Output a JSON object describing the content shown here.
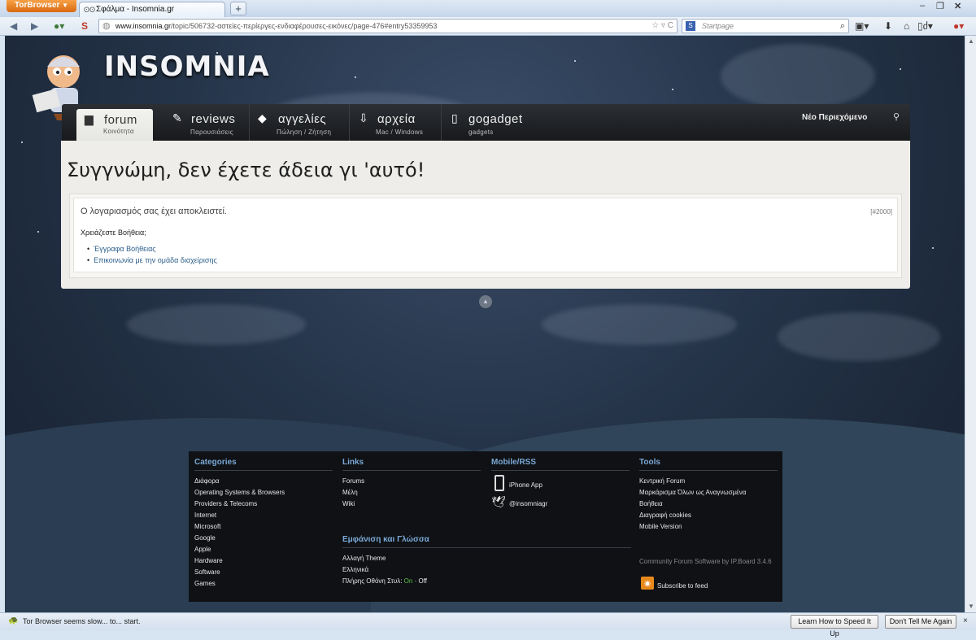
{
  "browser": {
    "tor_button": "TorBrowser",
    "tab_title": "Σφάλμα - Insomnia.gr",
    "new_tab": "+",
    "url_domain": "www.insomnia.gr",
    "url_path": "/topic/506732-αστείες-περίεργες-ενδιαφέρουσες-εικόνες/page-476#entry53359953",
    "search_engine_placeholder": "Startpage"
  },
  "site": {
    "logo": "INSOMNIA",
    "nav_tabs": [
      {
        "label": "forum",
        "sub": "Κοινότητα"
      },
      {
        "label": "reviews",
        "sub": "Παρουσιάσεις"
      },
      {
        "label": "αγγελίες",
        "sub": "Πώληση / Ζήτηση"
      },
      {
        "label": "αρχεία",
        "sub": "Mac / Windows"
      },
      {
        "label": "gogadget",
        "sub": "gadgets"
      }
    ],
    "new_content": "Νέο Περιεχόμενο"
  },
  "error": {
    "title": "Συγγνώμη, δεν έχετε άδεια γι 'αυτό!",
    "message": "Ο λογαριασμός σας έχει αποκλειστεί.",
    "code": "[#2000]",
    "help_question": "Χρειάζεστε Βοήθεια;",
    "help_links": [
      "Έγγραφα Βοήθειας",
      "Επικοινωνία με την ομάδα διαχείρισης"
    ]
  },
  "footer": {
    "categories": {
      "title": "Categories",
      "items": [
        "Διάφορα",
        "Operating Systems & Browsers",
        "Providers & Telecoms",
        "Internet",
        "Microsoft",
        "Google",
        "Apple",
        "Hardware",
        "Software",
        "Games"
      ]
    },
    "links": {
      "title": "Links",
      "items": [
        "Forums",
        "Μέλη",
        "Wiki"
      ]
    },
    "appearance": {
      "title": "Εμφάνιση και Γλώσσα",
      "change_theme": "Αλλαγή Theme",
      "language": "Ελληνικά",
      "fullscreen_label": "Πλήρης Οθόνη Στυλ:",
      "on": "On",
      "separator": "·",
      "off": "Off"
    },
    "mobile": {
      "title": "Mobile/RSS",
      "iphone": "iPhone App",
      "twitter": "@insomniagr"
    },
    "tools": {
      "title": "Tools",
      "items": [
        "Κεντρική Forum",
        "Μαρκάρισμα Όλων ως Αναγνωσμένα",
        "Βοήθεια",
        "Διαγραφή cookies",
        "Mobile Version"
      ],
      "credit": "Community Forum Software by IP.Board 3.4.6",
      "subscribe": "Subscribe to feed"
    }
  },
  "statusbar": {
    "message": "Tor Browser seems slow... to... start.",
    "learn_btn": "Learn How to Speed It Up",
    "dont_tell_btn": "Don't Tell Me Again",
    "close": "×"
  }
}
